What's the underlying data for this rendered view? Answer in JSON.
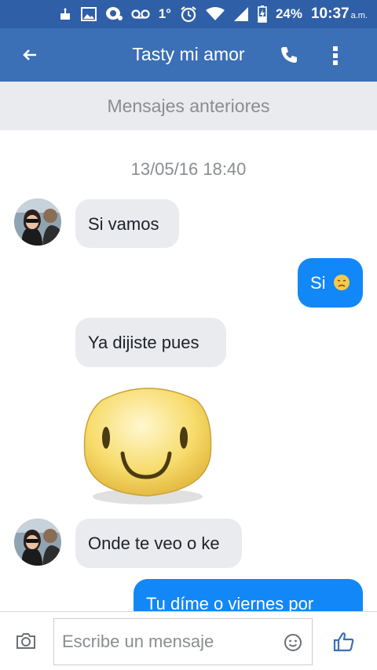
{
  "status_bar": {
    "signal_degree": "1°",
    "battery": "24%",
    "time": "10:37",
    "ampm": "a.m."
  },
  "header": {
    "title": "Tasty mi amor",
    "icons": [
      "back-arrow-icon",
      "phone-icon",
      "more-vert-icon"
    ]
  },
  "older_messages_label": "Mensajes anteriores",
  "timestamp": "13/05/16 18:40",
  "messages": [
    {
      "from": "contact",
      "text": "Si vamos"
    },
    {
      "from": "me",
      "text": "Si",
      "emoji": "sad-face-icon"
    },
    {
      "from": "contact",
      "text": "Ya dijiste pues"
    },
    {
      "from": "contact",
      "sticker": "smiley-sticker"
    },
    {
      "from": "contact",
      "text": "Onde te veo o ke"
    },
    {
      "from": "me",
      "text": "Tu díme o viernes por"
    }
  ],
  "composer": {
    "placeholder": "Escribe un mensaje",
    "icons": [
      "camera-icon",
      "emoji-icon",
      "thumbs-up-icon"
    ]
  },
  "colors": {
    "status_bar": "#2f5fa7",
    "app_bar": "#3b6fb6",
    "incoming_bubble": "#e9ebee",
    "outgoing_bubble": "#1287f8",
    "like_icon": "#3b6fb6"
  }
}
